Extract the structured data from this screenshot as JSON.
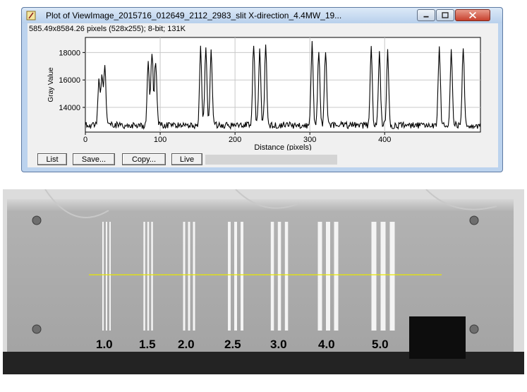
{
  "window": {
    "title": "Plot of ViewImage_2015716_012649_2112_2983_slit X-direction_4.4MW_19...",
    "info": "585.49x8584.26 pixels (528x255); 8-bit; 131K",
    "controls": {
      "minimize_icon": "minimize-icon",
      "maximize_icon": "maximize-icon",
      "close_icon": "close-icon"
    }
  },
  "toolbar": {
    "list_label": "List",
    "save_label": "Save...",
    "copy_label": "Copy...",
    "live_label": "Live"
  },
  "chart_data": {
    "type": "line",
    "xlabel": "Distance (pixels)",
    "ylabel": "Gray Value",
    "xlim": [
      0,
      528
    ],
    "ylim": [
      12200,
      19100
    ],
    "xticks": [
      0,
      100,
      200,
      300,
      400
    ],
    "xtick_labels": [
      "0",
      "100",
      "200",
      "300",
      "400"
    ],
    "yticks": [
      14000,
      16000,
      18000
    ],
    "ytick_labels": [
      "14000",
      "16000",
      "18000"
    ],
    "grid": true,
    "baseline": 12700,
    "series": [
      {
        "peaks": [
          {
            "x": 18,
            "y": 16000
          },
          {
            "x": 22,
            "y": 16500
          },
          {
            "x": 26,
            "y": 17100
          },
          {
            "x": 84,
            "y": 17500
          },
          {
            "x": 89,
            "y": 18400
          },
          {
            "x": 94,
            "y": 17800
          },
          {
            "x": 154,
            "y": 18600
          },
          {
            "x": 161,
            "y": 18700
          },
          {
            "x": 168,
            "y": 18600
          },
          {
            "x": 225,
            "y": 18800
          },
          {
            "x": 233,
            "y": 18600
          },
          {
            "x": 241,
            "y": 18500
          },
          {
            "x": 303,
            "y": 18800
          },
          {
            "x": 312,
            "y": 18500
          },
          {
            "x": 321,
            "y": 18700
          },
          {
            "x": 382,
            "y": 18700
          },
          {
            "x": 393,
            "y": 18500
          },
          {
            "x": 404,
            "y": 18500
          },
          {
            "x": 473,
            "y": 18800
          },
          {
            "x": 489,
            "y": 18700
          },
          {
            "x": 505,
            "y": 18800
          }
        ]
      }
    ]
  },
  "xray": {
    "groups": [
      {
        "label": "1.0",
        "lines": 3
      },
      {
        "label": "1.5",
        "lines": 3
      },
      {
        "label": "2.0",
        "lines": 3
      },
      {
        "label": "2.5",
        "lines": 3
      },
      {
        "label": "3.0",
        "lines": 3
      },
      {
        "label": "4.0",
        "lines": 3
      },
      {
        "label": "5.0",
        "lines": 3
      }
    ],
    "colors": {
      "line_profile": "#e8e800",
      "background": "#a9a9a9",
      "slit": "#f4f4f4"
    }
  }
}
